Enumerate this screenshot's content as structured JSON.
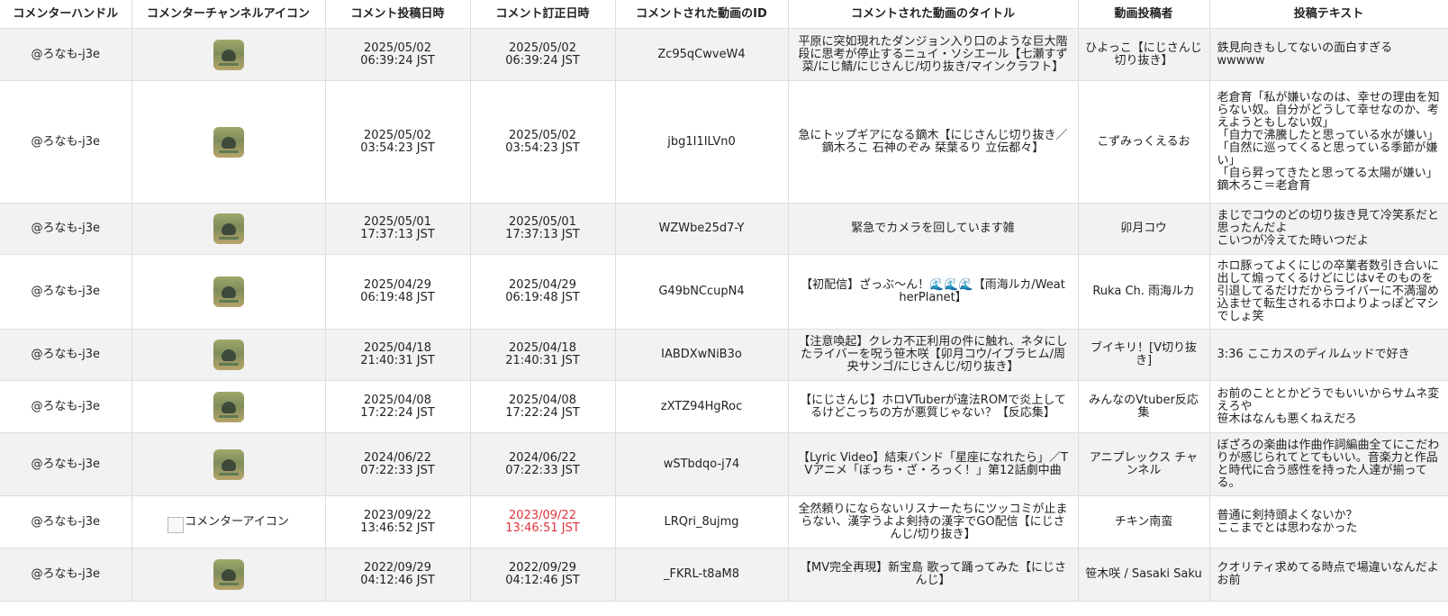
{
  "headers": [
    "コメンターハンドル",
    "コメンターチャンネルアイコン",
    "コメント投稿日時",
    "コメント訂正日時",
    "コメントされた動画のID",
    "コメントされた動画のタイトル",
    "動画投稿者",
    "投稿テキスト"
  ],
  "rows": [
    {
      "handle": "@ろなも-j3e",
      "icon": "avatar",
      "posted": "2025/05/02\n06:39:24 JST",
      "edited": "2025/05/02\n06:39:24 JST",
      "edited_flag": false,
      "video_id": "Zc95qCwveW4",
      "title": "平原に突如現れたダンジョン入り口のような巨大階段に思考が停止するニュイ・ソシエール【七瀬すず菜/にじ鯖/にじさんじ/切り抜き/マインクラフト】",
      "uploader": "ひよっこ【にじさんじ切り抜き】",
      "text": "鉄見向きもしてないの面白すぎる\nwwwww"
    },
    {
      "handle": "@ろなも-j3e",
      "icon": "avatar",
      "posted": "2025/05/02\n03:54:23 JST",
      "edited": "2025/05/02\n03:54:23 JST",
      "edited_flag": false,
      "video_id": "jbg1I1ILVn0",
      "title": "急にトップギアになる鏑木【にじさんじ切り抜き／鏑木ろこ 石神のぞみ 栞葉るり 立伝都々】",
      "uploader": "こずみっくえるお",
      "text": "老倉育「私が嫌いなのは、幸せの理由を知らない奴。自分がどうして幸せなのか、考えようともしない奴」\n「自力で沸騰したと思っている水が嫌い」\n「自然に巡ってくると思っている季節が嫌い」\n「自ら昇ってきたと思ってる太陽が嫌い」\n鏑木ろこ＝老倉育"
    },
    {
      "handle": "@ろなも-j3e",
      "icon": "avatar",
      "posted": "2025/05/01\n17:37:13 JST",
      "edited": "2025/05/01\n17:37:13 JST",
      "edited_flag": false,
      "video_id": "WZWbe25d7-Y",
      "title": "緊急でカメラを回しています雑",
      "uploader": "卯月コウ",
      "text": "まじでコウのどの切り抜き見て冷笑系だと思ったんだよ\nこいつが冷えてた時いつだよ"
    },
    {
      "handle": "@ろなも-j3e",
      "icon": "avatar",
      "posted": "2025/04/29\n06:19:48 JST",
      "edited": "2025/04/29\n06:19:48 JST",
      "edited_flag": false,
      "video_id": "G49bNCcupN4",
      "title": "【初配信】ざっぶ～ん！🌊🌊🌊【雨海ルカ/WeatherPlanet】",
      "uploader": "Ruka Ch. 雨海ルカ",
      "text": "ホロ豚ってよくにじの卒業者数引き合いに出して煽ってくるけどにじはvそのものを引退してるだけだからライバーに不満溜め込ませて転生されるホロよりよっぽどマシでしょ笑"
    },
    {
      "handle": "@ろなも-j3e",
      "icon": "avatar",
      "posted": "2025/04/18\n21:40:31 JST",
      "edited": "2025/04/18\n21:40:31 JST",
      "edited_flag": false,
      "video_id": "IABDXwNiB3o",
      "title": "【注意喚起】クレカ不正利用の件に触れ、ネタにしたライバーを呪う笹木咲【卯月コウ/イブラヒム/周央サンゴ/にじさんじ/切り抜き】",
      "uploader": "ブイキリ！[V切り抜き]",
      "text": "3:36 ここカスのディルムッドで好き"
    },
    {
      "handle": "@ろなも-j3e",
      "icon": "avatar",
      "posted": "2025/04/08\n17:22:24 JST",
      "edited": "2025/04/08\n17:22:24 JST",
      "edited_flag": false,
      "video_id": "zXTZ94HgRoc",
      "title": "【にじさんじ】ホロVTuberが違法ROMで炎上してるけどこっちの方が悪質じゃない？【反応集】",
      "uploader": "みんなのVtuber反応集",
      "text": "お前のこととかどうでもいいからサムネ変えろや\n笹木はなんも悪くねえだろ"
    },
    {
      "handle": "@ろなも-j3e",
      "icon": "avatar",
      "posted": "2024/06/22\n07:22:33 JST",
      "edited": "2024/06/22\n07:22:33 JST",
      "edited_flag": false,
      "video_id": "wSTbdqo-j74",
      "title": "【Lyric Video】結束バンド「星座になれたら」／TVアニメ「ぼっち・ざ・ろっく！」第12話劇中曲",
      "uploader": "アニプレックス チャンネル",
      "text": "ぼざろの楽曲は作曲作詞編曲全てにこだわりが感じられてとてもいい。音楽力と作品と時代に合う感性を持った人達が揃ってる。"
    },
    {
      "handle": "@ろなも-j3e",
      "icon": "broken",
      "icon_alt": "コメンターアイコン",
      "posted": "2023/09/22\n13:46:52 JST",
      "edited": "2023/09/22\n13:46:51 JST",
      "edited_flag": true,
      "video_id": "LRQri_8ujmg",
      "title": "全然頼りにならないリスナーたちにツッコミが止まらない、漢字うよよ剣持の漢字でGO配信【にじさんじ/切り抜き】",
      "uploader": "チキン南蛮",
      "text": "普通に剣持頭よくないか？\nここまでとは思わなかった"
    },
    {
      "handle": "@ろなも-j3e",
      "icon": "avatar",
      "posted": "2022/09/29\n04:12:46 JST",
      "edited": "2022/09/29\n04:12:46 JST",
      "edited_flag": false,
      "video_id": "_FKRL-t8aM8",
      "title": "【MV完全再現】新宝島 歌って踊ってみた【にじさんじ】",
      "uploader": "笹木咲 / Sasaki Saku",
      "text": "クオリティ求めてる時点で場違いなんだよお前"
    }
  ],
  "colors": {
    "stripe": "#f2f2f2",
    "edited_red": "#e0343a",
    "border": "#dddddd"
  }
}
